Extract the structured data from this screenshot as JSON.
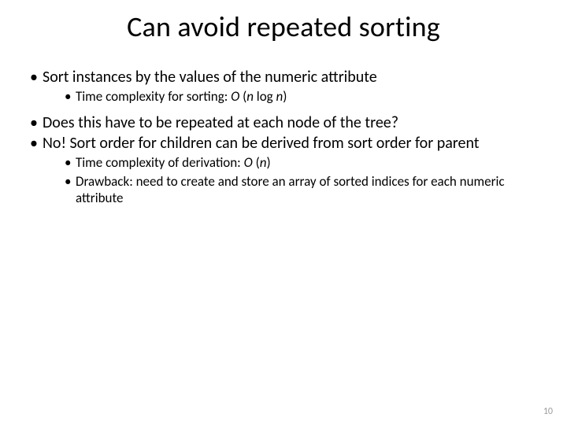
{
  "title": "Can avoid repeated sorting",
  "bullets": {
    "b1": "Sort instances by the values of the numeric attribute",
    "b1s1_a": "Time complexity for sorting: ",
    "b1s1_b": "O ",
    "b1s1_c": "(",
    "b1s1_d": "n",
    "b1s1_e": " log ",
    "b1s1_f": "n",
    "b1s1_g": ")",
    "b2": "Does this have to be repeated at each node of the tree?",
    "b3": "No! Sort order for children can be derived from sort order for parent",
    "b3s1_a": "Time complexity of derivation: ",
    "b3s1_b": "O ",
    "b3s1_c": "(",
    "b3s1_d": "n",
    "b3s1_e": ")",
    "b3s2": "Drawback: need to create and store an array of sorted indices for each numeric attribute"
  },
  "page_number": "10"
}
